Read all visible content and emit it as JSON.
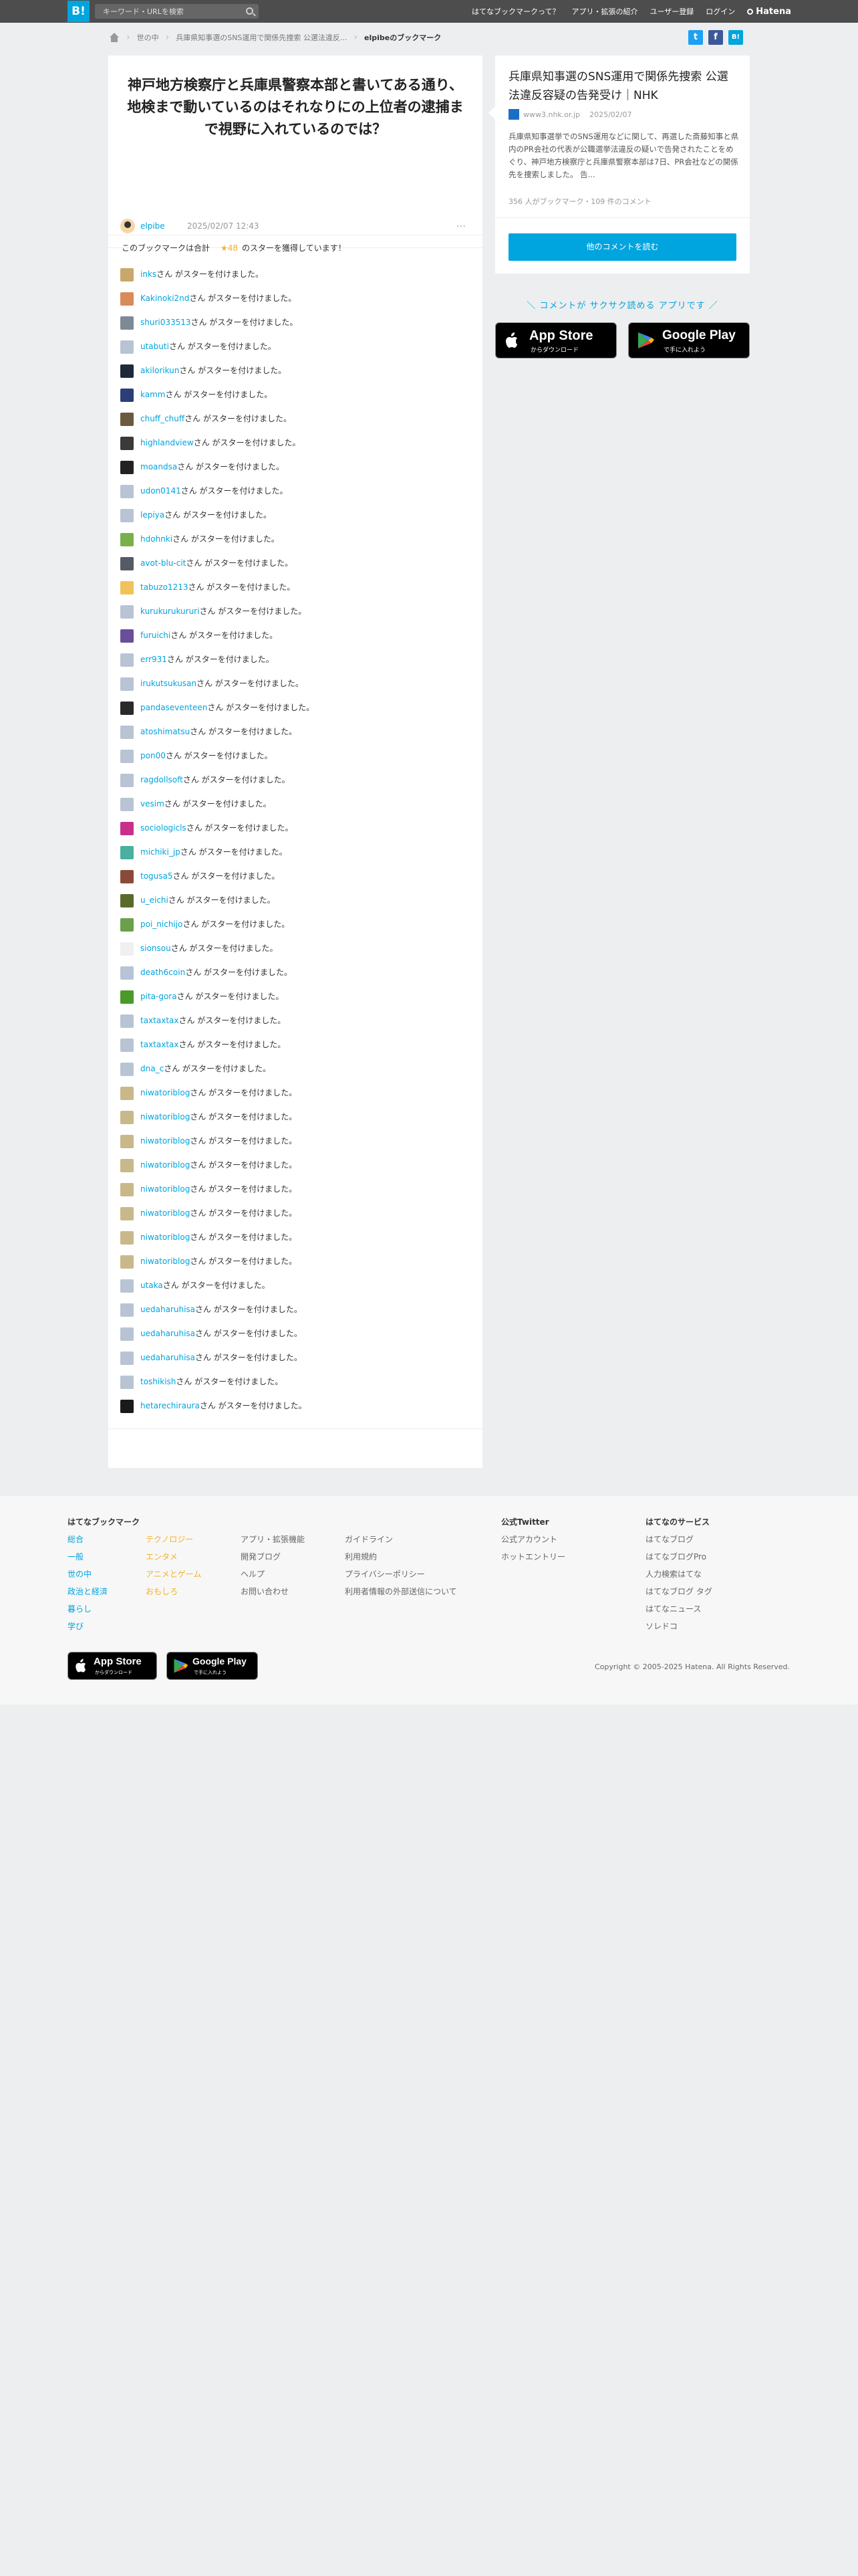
{
  "header": {
    "logo": "B!",
    "search_placeholder": "キーワード・URLを検索",
    "nav": [
      "はてなブックマークって？",
      "アプリ・拡張の紹介",
      "ユーザー登録",
      "ログイン"
    ],
    "brand": "Hatena"
  },
  "breadcrumb": {
    "items": [
      "世の中",
      "兵庫県知事選のSNS運用で関係先捜索 公選法違反..."
    ],
    "current": "elpibeのブックマーク"
  },
  "share": {
    "twitter": "t",
    "facebook": "f",
    "hatebu": "B!"
  },
  "entry": {
    "comment": "神戸地方検察庁と兵庫県警察本部と書いてある通り、地検まで動いているのはそれなりにの上位者の逮捕まで視野に入れているのでは？",
    "user": "elpibe",
    "date": "2025/02/07 12:43",
    "menu": "…",
    "summary_prefix": "このブックマークは合計",
    "star_count": "★48",
    "summary_suffix": "のスターを獲得しています！"
  },
  "star_suffix": "さん がスターを付けました。",
  "stars": [
    {
      "name": "inks",
      "color": "#c9a86b"
    },
    {
      "name": "Kakinoki2nd",
      "color": "#d98b5a"
    },
    {
      "name": "shuri033513",
      "color": "#7d8a96"
    },
    {
      "name": "utabuti",
      "color": "#b8c4d4"
    },
    {
      "name": "akilorikun",
      "color": "#1d2a3a"
    },
    {
      "name": "kamm",
      "color": "#2c3e7a"
    },
    {
      "name": "chuff_chuff",
      "color": "#6b5a3e"
    },
    {
      "name": "highlandview",
      "color": "#3a3a3a"
    },
    {
      "name": "moandsa",
      "color": "#222222"
    },
    {
      "name": "udon0141",
      "color": "#b8c4d4"
    },
    {
      "name": "lepiya",
      "color": "#b8c4d4"
    },
    {
      "name": "hdohnki",
      "color": "#7ab04a"
    },
    {
      "name": "avot-blu-cit",
      "color": "#555a66"
    },
    {
      "name": "tabuzo1213",
      "color": "#f0c25a"
    },
    {
      "name": "kurukurukururi",
      "color": "#b8c4d4"
    },
    {
      "name": "furuichi",
      "color": "#6a4e9a"
    },
    {
      "name": "err931",
      "color": "#b8c4d4"
    },
    {
      "name": "irukutsukusan",
      "color": "#b8c4d4"
    },
    {
      "name": "pandaseventeen",
      "color": "#2a2a2a"
    },
    {
      "name": "atoshimatsu",
      "color": "#b8c4d4"
    },
    {
      "name": "pon00",
      "color": "#b8c4d4"
    },
    {
      "name": "ragdollsoft",
      "color": "#b8c4d4"
    },
    {
      "name": "vesim",
      "color": "#b8c4d4"
    },
    {
      "name": "sociologicls",
      "color": "#c9308a"
    },
    {
      "name": "michiki_jp",
      "color": "#4ab0a0"
    },
    {
      "name": "togusa5",
      "color": "#8a4a3a"
    },
    {
      "name": "u_eichi",
      "color": "#5a6a2a"
    },
    {
      "name": "poi_nichijo",
      "color": "#6aa04a"
    },
    {
      "name": "sionsou",
      "color": "#f0f0f0"
    },
    {
      "name": "death6coin",
      "color": "#b8c4d4"
    },
    {
      "name": "pita-gora",
      "color": "#4a9a2a"
    },
    {
      "name": "taxtaxtax",
      "color": "#b8c4d4"
    },
    {
      "name": "taxtaxtax",
      "color": "#b8c4d4"
    },
    {
      "name": "dna_c",
      "color": "#b8c4d4"
    },
    {
      "name": "niwatoriblog",
      "color": "#c9b88a"
    },
    {
      "name": "niwatoriblog",
      "color": "#c9b88a"
    },
    {
      "name": "niwatoriblog",
      "color": "#c9b88a"
    },
    {
      "name": "niwatoriblog",
      "color": "#c9b88a"
    },
    {
      "name": "niwatoriblog",
      "color": "#c9b88a"
    },
    {
      "name": "niwatoriblog",
      "color": "#c9b88a"
    },
    {
      "name": "niwatoriblog",
      "color": "#c9b88a"
    },
    {
      "name": "niwatoriblog",
      "color": "#c9b88a"
    },
    {
      "name": "utaka",
      "color": "#b8c4d4"
    },
    {
      "name": "uedaharuhisa",
      "color": "#b8c4d4"
    },
    {
      "name": "uedaharuhisa",
      "color": "#b8c4d4"
    },
    {
      "name": "uedaharuhisa",
      "color": "#b8c4d4"
    },
    {
      "name": "toshikish",
      "color": "#b8c4d4"
    },
    {
      "name": "hetarechiraura",
      "color": "#1a1a1a"
    }
  ],
  "article": {
    "title": "兵庫県知事選のSNS運用で関係先捜索 公選法違反容疑の告発受け｜NHK",
    "domain": "www3.nhk.or.jp",
    "date": "2025/02/07",
    "description": "兵庫県知事選挙でのSNS運用などに関して、再選した斎藤知事と県内のPR会社の代表が公職選挙法違反の疑いで告発されたことをめぐり、神戸地方検察庁と兵庫県警察本部は7日、PR会社などの関係先を捜索しました。 告...",
    "stats": "356 人がブックマーク・109 件のコメント",
    "read_button": "他のコメントを読む"
  },
  "app": {
    "tagline": "＼ コメントが サクサク読める アプリです ／",
    "appstore_big": "App Store",
    "appstore_small": "からダウンロード",
    "googleplay_big": "Google Play",
    "googleplay_small": "で手に入れよう"
  },
  "footer": {
    "col1_title": "はてなブックマーク",
    "col1a": [
      "総合",
      "一般",
      "世の中",
      "政治と経済",
      "暮らし",
      "学び"
    ],
    "col1b": [
      "テクノロジー",
      "エンタメ",
      "アニメとゲーム",
      "おもしろ"
    ],
    "col1c": [
      "アプリ・拡張機能",
      "開発ブログ",
      "ヘルプ",
      "お問い合わせ"
    ],
    "col1d": [
      "ガイドライン",
      "利用規約",
      "プライバシーポリシー",
      "利用者情報の外部送信について"
    ],
    "twitter_title": "公式Twitter",
    "twitter_links": [
      "公式アカウント",
      "ホットエントリー"
    ],
    "services_title": "はてなのサービス",
    "services": [
      "はてなブログ",
      "はてなブログPro",
      "人力検索はてな",
      "はてなブログ タグ",
      "はてなニュース",
      "ソレドコ"
    ],
    "copyright": "Copyright © 2005-2025 Hatena. All Rights Reserved."
  },
  "colors": {
    "accent": "#00a4de",
    "star": "#f4b128",
    "header": "#4d4d4d"
  }
}
